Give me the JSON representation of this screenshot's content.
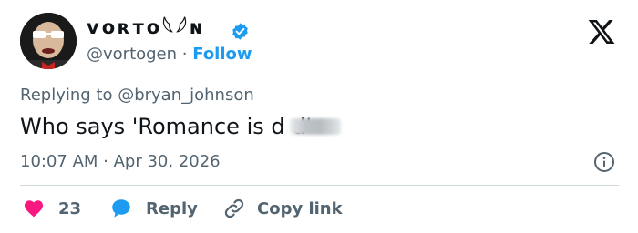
{
  "header": {
    "display_name": "ᴠᴏʀᴛᴏ𓆩𓆪ɴ",
    "handle": "@vortogen",
    "separator": "·",
    "follow_label": "Follow"
  },
  "tweet": {
    "replying_to": "Replying to @bryan_johnson",
    "text": "Who says 'Romance is d      d'",
    "timestamp": "10:07 AM · Apr 30, 2026"
  },
  "actions": {
    "like_count": "23",
    "reply_label": "Reply",
    "copy_link_label": "Copy link"
  },
  "colors": {
    "accent": "#1d9bf0",
    "like": "#f91880",
    "text": "#0f1419",
    "muted": "#536471"
  },
  "icons": [
    "avatar",
    "verified-badge-icon",
    "x-logo-icon",
    "info-icon",
    "heart-icon",
    "reply-bubble-icon",
    "link-icon"
  ]
}
